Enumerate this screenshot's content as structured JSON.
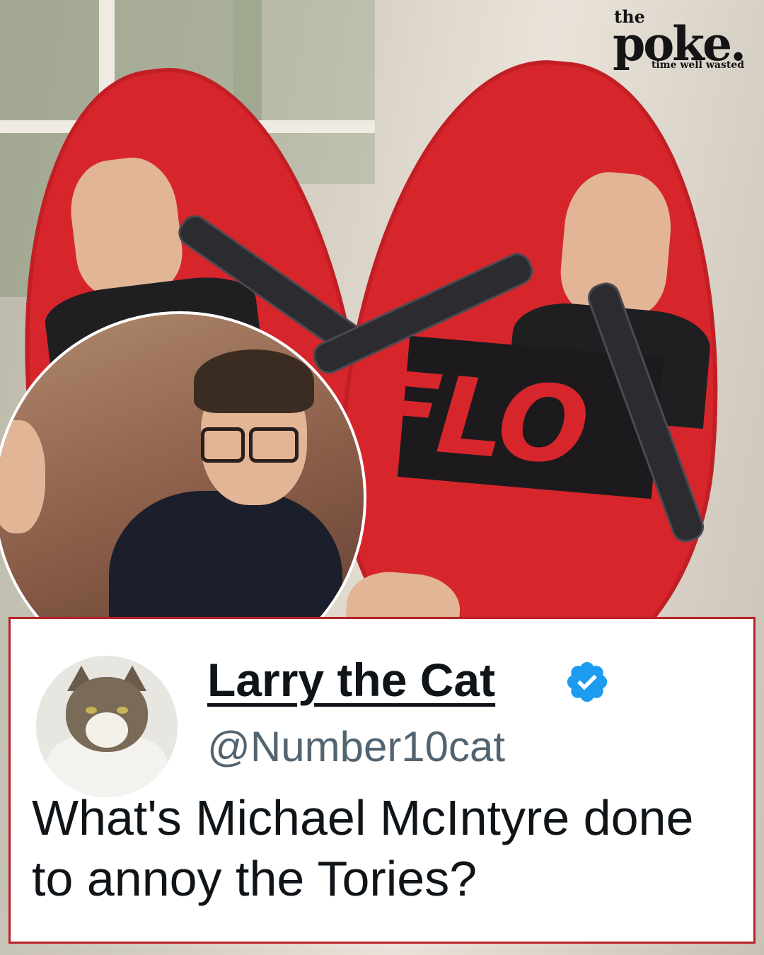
{
  "logo": {
    "the": "the",
    "poke": "poke.",
    "tagline": "time well wasted"
  },
  "photo": {
    "slogan_visible": "FLO"
  },
  "tweet": {
    "display_name": "Larry the Cat",
    "handle": "@Number10cat",
    "verified": true,
    "text": "What's Michael McIntyre done to annoy the Tories?",
    "colors": {
      "border": "#b8222a",
      "verified_badge": "#1d9bf0",
      "handle": "#536471"
    }
  }
}
